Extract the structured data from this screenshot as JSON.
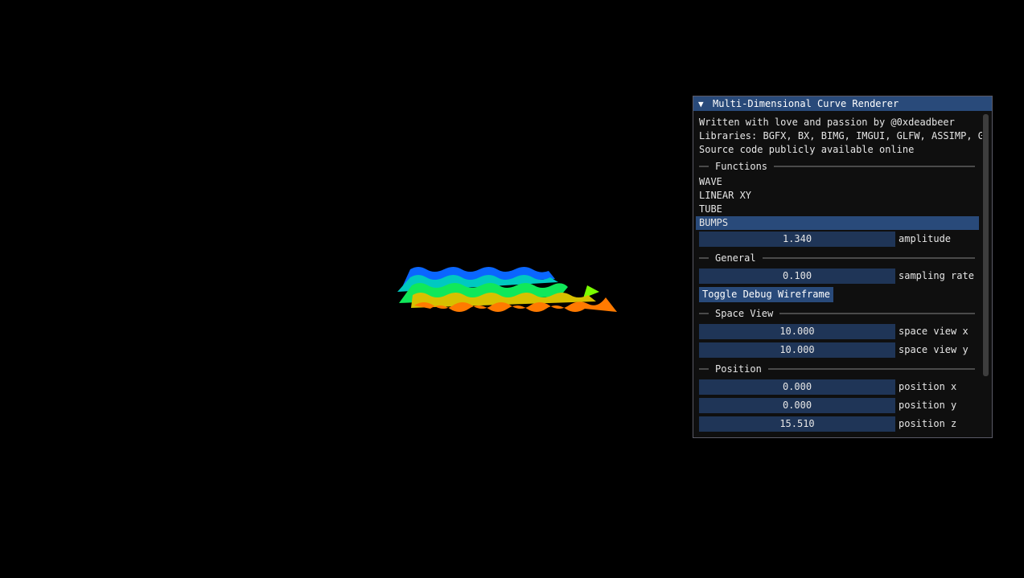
{
  "window": {
    "title": "Multi-Dimensional Curve Renderer",
    "credits": "Written with love and passion by @0xdeadbeer",
    "libraries": "Libraries: BGFX, BX, BIMG, IMGUI, GLFW, ASSIMP, GLM",
    "source": "Source code publicly available online"
  },
  "functions": {
    "header": "Functions",
    "items": [
      "WAVE",
      "LINEAR XY",
      "TUBE",
      "BUMPS"
    ],
    "selected": "BUMPS",
    "amplitude_value": "1.340",
    "amplitude_label": "amplitude"
  },
  "general": {
    "header": "General",
    "sampling_value": "0.100",
    "sampling_label": "sampling rate",
    "toggle_button": "Toggle Debug Wireframe"
  },
  "space_view": {
    "header": "Space View",
    "x_value": "10.000",
    "x_label": "space view x",
    "y_value": "10.000",
    "y_label": "space view y"
  },
  "position": {
    "header": "Position",
    "x_value": "0.000",
    "x_label": "position x",
    "y_value": "0.000",
    "y_label": "position y",
    "z_value": "15.510",
    "z_label": "position z"
  },
  "colors": {
    "title_bar": "#294a7a",
    "selected_item": "#294a7a",
    "drag_field": "#1f3557",
    "background": "#000000"
  }
}
